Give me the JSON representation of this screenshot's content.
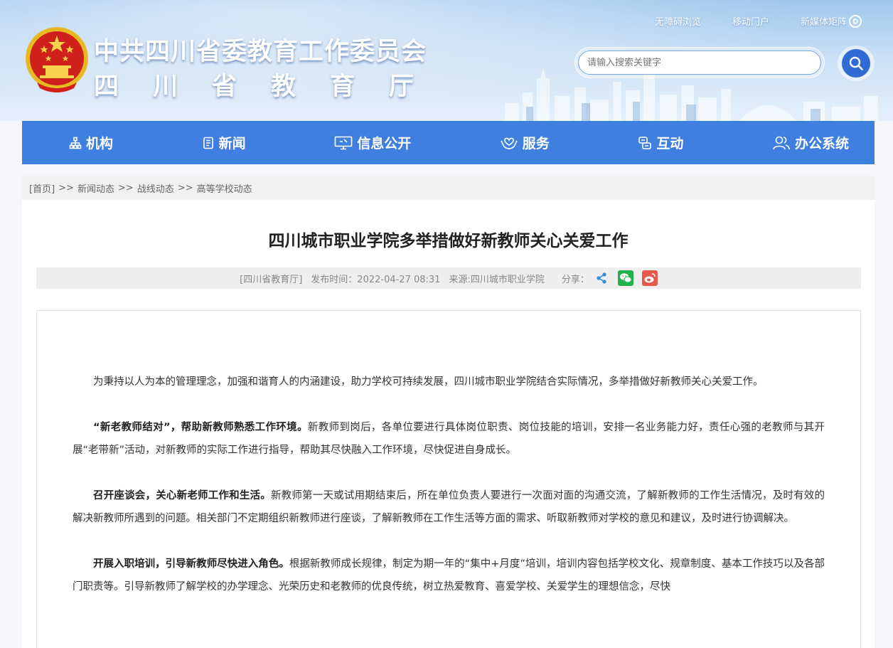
{
  "header": {
    "title_cn": "中共四川省委教育工作委员会",
    "title_dept_chars": [
      "四",
      "川",
      "省",
      "教",
      "育",
      "厅"
    ],
    "top_links": [
      {
        "label": "无障碍浏览"
      },
      {
        "label": "移动门户"
      },
      {
        "label": "新媒体矩阵"
      }
    ],
    "search_placeholder": "请输入搜索关键字"
  },
  "nav": {
    "items": [
      {
        "label": "机构",
        "icon": "org-icon"
      },
      {
        "label": "新闻",
        "icon": "news-icon"
      },
      {
        "label": "信息公开",
        "icon": "monitor-icon"
      },
      {
        "label": "服务",
        "icon": "service-icon"
      },
      {
        "label": "互动",
        "icon": "interact-icon"
      },
      {
        "label": "办公系统",
        "icon": "users-icon"
      }
    ]
  },
  "breadcrumb": {
    "home": "[首页]",
    "sep": ">>",
    "items": [
      "新闻动态",
      "战线动态",
      "高等学校动态"
    ]
  },
  "article": {
    "title": "四川城市职业学院多举措做好新教师关心关爱工作",
    "meta": {
      "site": "[四川省教育厅]",
      "publish": "发布时间：2022-04-27 08:31",
      "source": "来源:四川城市职业学院",
      "share_label": "分享："
    },
    "paragraphs": [
      {
        "lead": "",
        "text": "为秉持以人为本的管理理念，加强和谐育人的内涵建设，助力学校可持续发展，四川城市职业学院结合实际情况，多举措做好新教师关心关爱工作。"
      },
      {
        "lead": "“新老教师结对”，帮助新教师熟悉工作环境。",
        "text": "新教师到岗后，各单位要进行具体岗位职责、岗位技能的培训，安排一名业务能力好，责任心强的老教师与其开展“老带新”活动，对新教师的实际工作进行指导，帮助其尽快融入工作环境，尽快促进自身成长。"
      },
      {
        "lead": "召开座谈会，关心新老师工作和生活。",
        "text": "新教师第一天或试用期结束后，所在单位负责人要进行一次面对面的沟通交流，了解新教师的工作生活情况，及时有效的解决新教师所遇到的问题。相关部门不定期组织新教师进行座谈，了解新教师在工作生活等方面的需求、听取新教师对学校的意见和建议，及时进行协调解决。"
      },
      {
        "lead": "开展入职培训，引导新教师尽快进入角色。",
        "text": "根据新教师成长规律，制定为期一年的“集中+月度”培训，培训内容包括学校文化、规章制度、基本工作技巧以及各部门职责等。引导新教师了解学校的办学理念、光荣历史和老教师的优良传统，树立热爱教育、喜爱学校、关爱学生的理想信念，尽快"
      }
    ]
  },
  "colors": {
    "nav_blue": "#3f7fe0",
    "search_blue": "#2f6bd2",
    "wechat_green": "#23b14d",
    "weibo_red": "#e9584c"
  }
}
